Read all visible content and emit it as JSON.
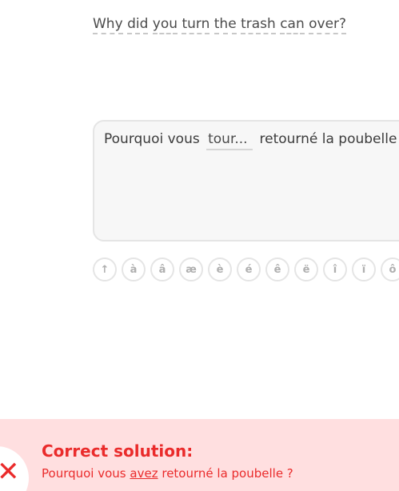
{
  "prompt": {
    "words": [
      "Why",
      "did",
      "you",
      "turn",
      "the",
      "trash",
      "can",
      "over?"
    ]
  },
  "answer": {
    "before": "Pourquoi vous",
    "blank": "tour...",
    "after": "retourné la poubelle ?"
  },
  "keyboard": {
    "keys": [
      "↑",
      "à",
      "â",
      "æ",
      "è",
      "é",
      "ê",
      "ë",
      "î",
      "ï",
      "ô"
    ]
  },
  "feedback": {
    "icon": "close-icon",
    "title": "Correct solution:",
    "solution_before": "Pourquoi vous",
    "solution_highlight": "avez",
    "solution_after": "retourné la poubelle ?",
    "color": "#ea2b2b",
    "background": "#ffdfe0"
  }
}
